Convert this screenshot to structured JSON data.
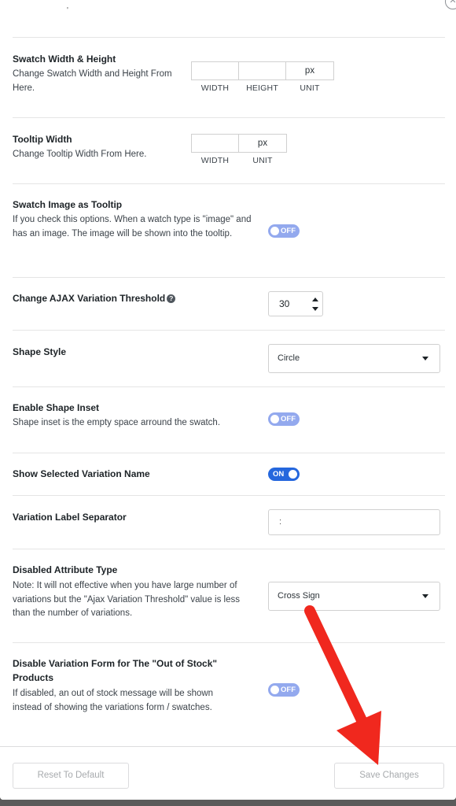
{
  "settings": {
    "swatch_size": {
      "title": "Swatch Width & Height",
      "desc": "Change Swatch Width and Height From Here.",
      "width_value": "",
      "height_value": "",
      "unit_value": "px",
      "caption_width": "WIDTH",
      "caption_height": "HEIGHT",
      "caption_unit": "UNIT"
    },
    "tooltip_width": {
      "title": "Tooltip Width",
      "desc": "Change Tooltip Width From Here.",
      "width_value": "",
      "unit_value": "px",
      "caption_width": "WIDTH",
      "caption_unit": "UNIT"
    },
    "image_tooltip": {
      "title": "Swatch Image as Tooltip",
      "desc": "If you check this options. When a watch type is \"image\" and has an image. The image will be shown into the tooltip.",
      "toggle": "OFF"
    },
    "ajax_threshold": {
      "title": "Change AJAX Variation Threshold",
      "help_icon": "?",
      "value": "30"
    },
    "shape_style": {
      "title": "Shape Style",
      "selected": "Circle"
    },
    "shape_inset": {
      "title": "Enable Shape Inset",
      "desc": "Shape inset is the empty space arround the swatch.",
      "toggle": "OFF"
    },
    "selected_variation_name": {
      "title": "Show Selected Variation Name",
      "toggle": "ON"
    },
    "label_separator": {
      "title": "Variation Label Separator",
      "value": ":"
    },
    "disabled_attribute": {
      "title": "Disabled Attribute Type",
      "desc": "Note: It will not effective when you have large number of variations but the \"Ajax Variation Threshold\" value is less than the number of variations.",
      "selected": "Cross Sign"
    },
    "disable_form_oos": {
      "title": "Disable Variation Form for The \"Out of Stock\" Products",
      "desc": "If disabled, an out of stock message will be shown instead of showing the variations form / swatches.",
      "toggle": "OFF"
    }
  },
  "footer": {
    "reset_label": "Reset To Default",
    "save_label": "Save Changes"
  },
  "colors": {
    "toggle_on": "#2567dd",
    "toggle_off": "#93a9ee",
    "annotation_arrow": "#f0281e"
  },
  "icons": {
    "close": "close-icon",
    "help": "help-circle-icon",
    "arrow": "red-arrow-annotation"
  }
}
